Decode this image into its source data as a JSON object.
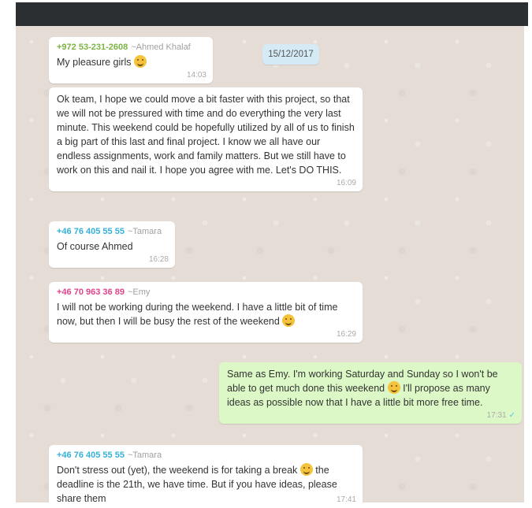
{
  "date_badge": "15/12/2017",
  "messages": [
    {
      "sender_phone": "+972 53-231-2608",
      "sender_name": "~Ahmed Khalaf",
      "sender_color": "#7cb342",
      "text": "My pleasure girls",
      "time": "14:03",
      "emoji": "grinning-emoji"
    },
    {
      "text": "Ok team, I hope we could move a bit faster with this project, so that we will not be pressured with time and do everything the very last minute. This weekend could be hopefully utilized by all of us to finish a big part of this last and final project. I know we all have our endless assignments, work and family matters. But we still have to work on this and nail it. I hope you agree with me. Let's DO THIS.",
      "time": "16:09"
    },
    {
      "sender_phone": "+46 76 405 55 55",
      "sender_name": "~Tamara",
      "sender_color": "#35b0d8",
      "text": "Of course Ahmed",
      "time": "16:28"
    },
    {
      "sender_phone": "+46 70 963 36 89",
      "sender_name": "~Emy",
      "sender_color": "#e0448a",
      "text": "I will not be working during the weekend. I have a little bit of time now, but then I will be busy the rest of the weekend",
      "time": "16:29",
      "emoji": "grimacing-emoji"
    },
    {
      "text_a": "Same as Emy. I'm working Saturday and Sunday so I won't be able to get much done this weekend",
      "text_b": "I'll propose as many ideas as possible now that I have a little bit more free time.",
      "time": "17:31",
      "status": "sent-check",
      "emoji": "disappointed-emoji"
    },
    {
      "sender_phone": "+46 76 405 55 55",
      "sender_name": "~Tamara",
      "sender_color": "#35b0d8",
      "text_a": "Don't stress out (yet), the weekend is for taking a break",
      "text_b": "the deadline is the 21th, we have time. But if you have ideas, please share them",
      "time": "17:41",
      "emoji": "relieved-emoji"
    }
  ]
}
